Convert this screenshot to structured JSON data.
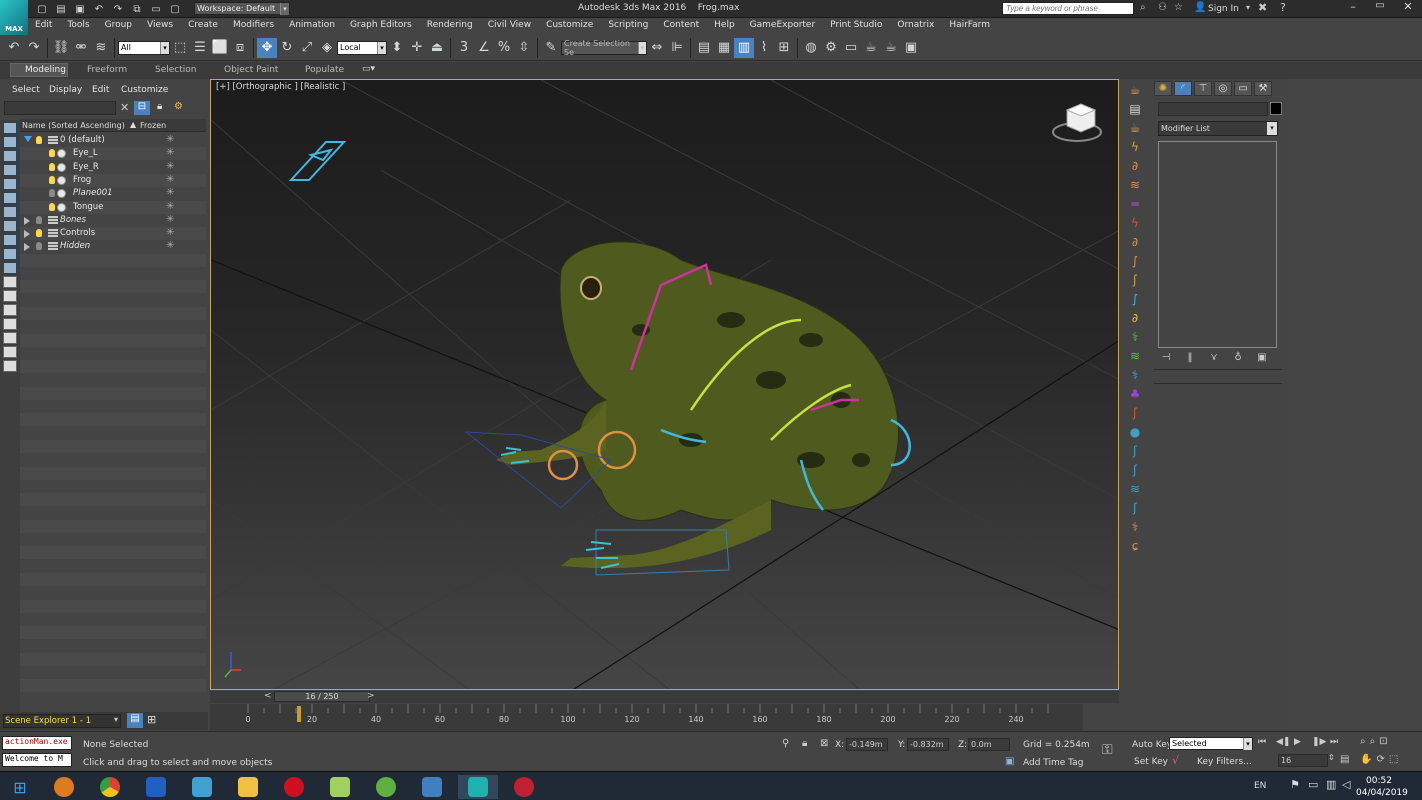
{
  "app": {
    "title": "Autodesk 3ds Max 2016",
    "file": "Frog.max",
    "logo": "MAX",
    "workspace": "Workspace: Default",
    "search_placeholder": "Type a keyword or phrase",
    "sign_in": "Sign In"
  },
  "menu": [
    "Edit",
    "Tools",
    "Group",
    "Views",
    "Create",
    "Modifiers",
    "Animation",
    "Graph Editors",
    "Rendering",
    "Civil View",
    "Customize",
    "Scripting",
    "Content",
    "Help",
    "GameExporter",
    "Print Studio",
    "Ornatrix",
    "HairFarm"
  ],
  "toolbar": {
    "selection_filter": "All",
    "reference_coord": "Local",
    "named_selection_set": "Create Selection Se"
  },
  "ribbon": {
    "tabs": [
      "Modeling",
      "Freeform",
      "Selection",
      "Object Paint",
      "Populate"
    ],
    "active": "Modeling"
  },
  "explorer": {
    "menu": [
      "Select",
      "Display",
      "Edit",
      "Customize"
    ],
    "col_name": "Name (Sorted Ascending)",
    "col_frozen": "Frozen",
    "frozen_glyph": "✳",
    "rows": [
      {
        "label": "0 (default)",
        "italic": false
      },
      {
        "label": "Eye_L",
        "italic": false
      },
      {
        "label": "Eye_R",
        "italic": false
      },
      {
        "label": "Frog",
        "italic": false
      },
      {
        "label": "Plane001",
        "italic": true
      },
      {
        "label": "Tongue",
        "italic": false
      },
      {
        "label": "Bones",
        "italic": true
      },
      {
        "label": "Controls",
        "italic": false
      },
      {
        "label": "Hidden",
        "italic": true
      }
    ],
    "footer": "Scene Explorer 1 - 1"
  },
  "viewport": {
    "label": "[+] [Orthographic ] [Realistic ]",
    "border_color": "#c8a45a"
  },
  "command_panel": {
    "modifier_list": "Modifier List"
  },
  "timeline": {
    "frame": "16 / 250",
    "prev": "<",
    "next": ">",
    "ticks": [
      "0",
      "20",
      "40",
      "60",
      "80",
      "100",
      "120",
      "140",
      "160",
      "180",
      "200",
      "220",
      "240"
    ]
  },
  "status": {
    "maxscript_1": "actionMan.exe",
    "maxscript_2": "Welcome to M",
    "selection": "None Selected",
    "prompt": "Click and drag to select and move objects",
    "x_label": "X:",
    "x": "-0.149m",
    "y_label": "Y:",
    "y": "-0.832m",
    "z_label": "Z:",
    "z": "0.0m",
    "grid": "Grid = 0.254m",
    "add_time_tag": "Add Time Tag",
    "auto_key": "Auto Key",
    "set_key": "Set Key",
    "key_mode": "Selected",
    "key_filters": "Key Filters...",
    "current_frame": "16"
  },
  "taskbar": {
    "lang": "EN",
    "time": "00:52",
    "date": "04/04/2019",
    "apps": [
      "chrome",
      "media",
      "explorer",
      "opera",
      "folder",
      "utorrent",
      "remote",
      "max",
      "rec"
    ]
  }
}
